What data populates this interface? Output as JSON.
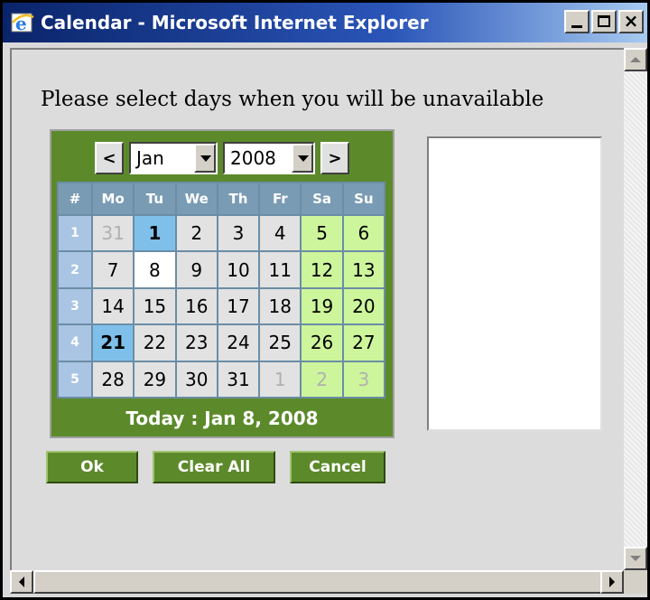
{
  "window": {
    "title": "Calendar - Microsoft Internet Explorer"
  },
  "instruction": "Please select days when you will be unavailable",
  "calendar": {
    "prev_label": "<",
    "next_label": ">",
    "month": "Jan",
    "year": "2008",
    "headers": [
      "#",
      "Mo",
      "Tu",
      "We",
      "Th",
      "Fr",
      "Sa",
      "Su"
    ],
    "weeks": [
      {
        "num": "1",
        "days": [
          "31",
          "1",
          "2",
          "3",
          "4",
          "5",
          "6"
        ]
      },
      {
        "num": "2",
        "days": [
          "7",
          "8",
          "9",
          "10",
          "11",
          "12",
          "13"
        ]
      },
      {
        "num": "3",
        "days": [
          "14",
          "15",
          "16",
          "17",
          "18",
          "19",
          "20"
        ]
      },
      {
        "num": "4",
        "days": [
          "21",
          "22",
          "23",
          "24",
          "25",
          "26",
          "27"
        ]
      },
      {
        "num": "5",
        "days": [
          "28",
          "29",
          "30",
          "31",
          "1",
          "2",
          "3"
        ]
      }
    ],
    "today_label": "Today : Jan 8, 2008",
    "colors": {
      "green": "#5c8a2a",
      "weekend": "#cdf59b",
      "selected": "#7ec0ea",
      "header": "#7a9bb4",
      "week_col": "#a9c5e3"
    }
  },
  "buttons": {
    "ok": "Ok",
    "clear_all": "Clear All",
    "cancel": "Cancel"
  }
}
